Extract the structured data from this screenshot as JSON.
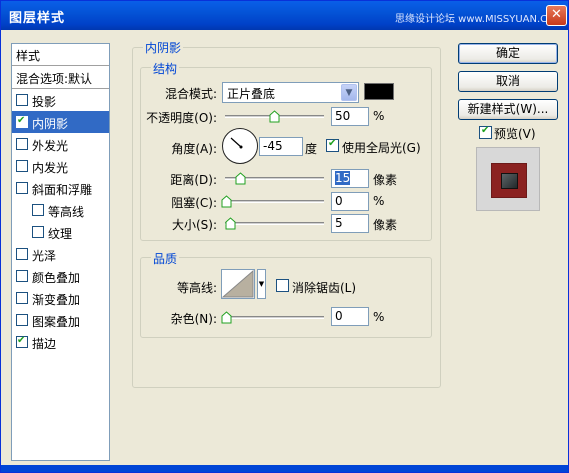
{
  "window": {
    "title": "图层样式",
    "watermark": "思缘设计论坛 www.MISSYUAN.COM",
    "close_symbol": "✕"
  },
  "sidebar": {
    "header": "样式",
    "blend_options": "混合选项:默认",
    "items": [
      {
        "label": "投影",
        "checked": false
      },
      {
        "label": "内阴影",
        "checked": true,
        "selected": true
      },
      {
        "label": "外发光",
        "checked": false
      },
      {
        "label": "内发光",
        "checked": false
      },
      {
        "label": "斜面和浮雕",
        "checked": false
      },
      {
        "label": "等高线",
        "checked": false,
        "indent": true
      },
      {
        "label": "纹理",
        "checked": false,
        "indent": true
      },
      {
        "label": "光泽",
        "checked": false
      },
      {
        "label": "颜色叠加",
        "checked": false
      },
      {
        "label": "渐变叠加",
        "checked": false
      },
      {
        "label": "图案叠加",
        "checked": false
      },
      {
        "label": "描边",
        "checked": true
      }
    ]
  },
  "inner_shadow": {
    "title": "内阴影",
    "structure": {
      "title": "结构",
      "blend_mode_label": "混合模式:",
      "blend_mode_value": "正片叠底",
      "shadow_color": "#000000",
      "opacity_label": "不透明度(O):",
      "opacity_value": "50",
      "opacity_unit": "%",
      "angle_label": "角度(A):",
      "angle_value": "-45",
      "angle_unit": "度",
      "global_light_label": "使用全局光(G)",
      "global_light_checked": true,
      "distance_label": "距离(D):",
      "distance_value": "15",
      "distance_unit": "像素",
      "choke_label": "阻塞(C):",
      "choke_value": "0",
      "choke_unit": "%",
      "size_label": "大小(S):",
      "size_value": "5",
      "size_unit": "像素"
    },
    "quality": {
      "title": "品质",
      "contour_label": "等高线:",
      "anti_alias_label": "消除锯齿(L)",
      "anti_alias_checked": false,
      "noise_label": "杂色(N):",
      "noise_value": "0",
      "noise_unit": "%"
    }
  },
  "buttons": {
    "ok": "确定",
    "cancel": "取消",
    "new_style": "新建样式(W)...",
    "preview": "预览(V)",
    "preview_checked": true
  },
  "colors": {
    "selection": "#316ac5",
    "title_bar": "#0453d6",
    "accent_title": "#0046d5"
  }
}
